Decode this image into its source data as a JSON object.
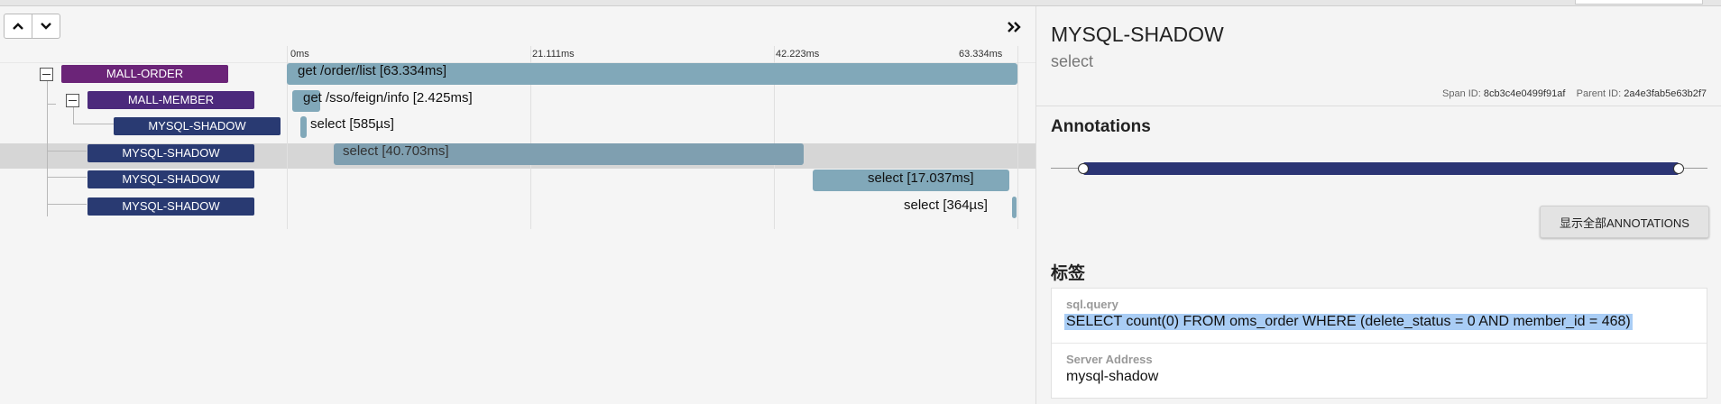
{
  "timeline": {
    "ticks": [
      "0ms",
      "21.111ms",
      "42.223ms",
      "63.334ms"
    ],
    "spans": [
      {
        "service": "MALL-ORDER",
        "label": "get /order/list [63.334ms]",
        "start_ms": 0,
        "duration_ms": 63.334
      },
      {
        "service": "MALL-MEMBER",
        "label": "get /sso/feign/info [2.425ms]",
        "start_ms": 0.5,
        "duration_ms": 2.425
      },
      {
        "service": "MYSQL-SHADOW",
        "label": "select [585µs]",
        "start_ms": 1.15,
        "duration_ms": 0.585
      },
      {
        "service": "MYSQL-SHADOW",
        "label": "select [40.703ms]",
        "start_ms": 4.1,
        "duration_ms": 40.703
      },
      {
        "service": "MYSQL-SHADOW",
        "label": "select [17.037ms]",
        "start_ms": 45.6,
        "duration_ms": 17.037
      },
      {
        "service": "MYSQL-SHADOW",
        "label": "select [364µs]",
        "start_ms": 62.9,
        "duration_ms": 0.364
      }
    ]
  },
  "detail": {
    "service": "MYSQL-SHADOW",
    "name": "select",
    "span_id_label": "Span ID:",
    "span_id": "8cb3c4e0499f91af",
    "parent_id_label": "Parent ID:",
    "parent_id": "2a4e3fab5e63b2f7",
    "annotations_title": "Annotations",
    "show_all_label": "显示全部ANNOTATIONS",
    "tags_title": "标签",
    "tags": [
      {
        "key": "sql.query",
        "value": "SELECT count(0) FROM oms_order WHERE (delete_status = 0 AND member_id = 468)"
      },
      {
        "key": "Server Address",
        "value": "mysql-shadow"
      }
    ]
  },
  "colors": {
    "order_service": "#6b2478",
    "member_service": "#4c2a7c",
    "mysql_service": "#293a72",
    "span_bar": "#81a8b9",
    "annotation_bar": "#2b3474"
  },
  "icons": [
    "chevron-up-icon",
    "chevron-down-icon",
    "double-chevron-right-icon",
    "collapse-toggle-icon"
  ]
}
